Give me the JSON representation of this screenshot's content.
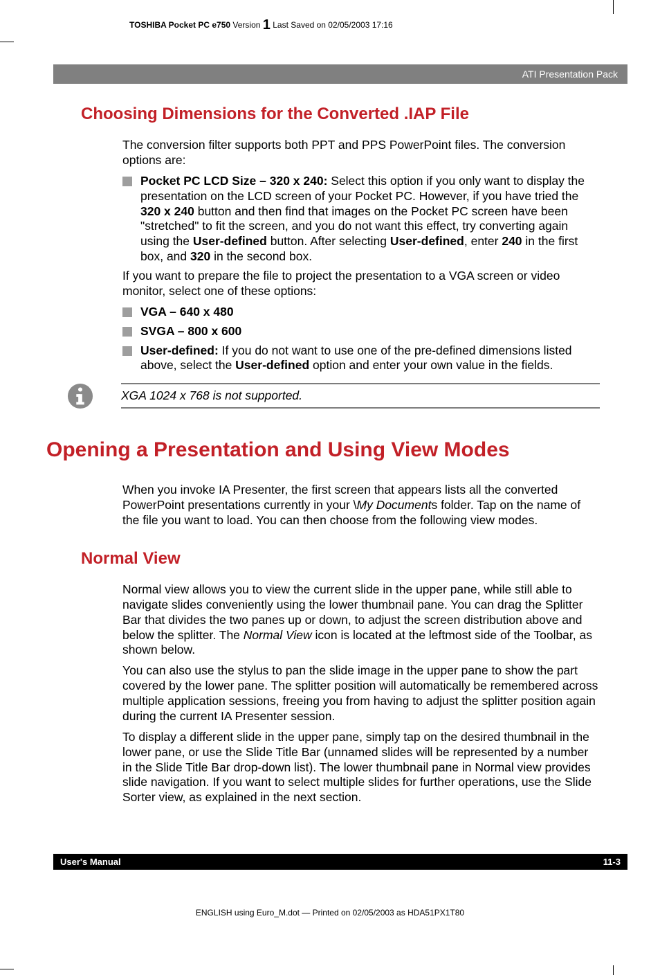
{
  "header": {
    "product": "TOSHIBA Pocket PC e750",
    "version_label": "Version",
    "version_num": "1",
    "save_info": "Last Saved on 02/05/2003 17:16"
  },
  "banner": "ATI Presentation Pack",
  "h2_1": "Choosing Dimensions for the Converted .IAP File",
  "p1": "The conversion filter supports both PPT and PPS PowerPoint files. The conversion options are:",
  "li1_lead": "Pocket PC LCD Size – 320 x 240:",
  "li1_a": " Select this option if you only want to display the presentation on the LCD screen of your Pocket PC. However, if you have tried the ",
  "li1_b": "320 x 240",
  "li1_c": " button and then find that images on the Pocket PC screen have been \"stretched\" to fit the screen, and you do not want this effect, try converting again using the ",
  "li1_d": "User-defined",
  "li1_e": " button. After selecting ",
  "li1_f": "User-defined",
  "li1_g": ", enter ",
  "li1_h": "240",
  "li1_i": " in the first box, and ",
  "li1_j": "320",
  "li1_k": " in the second box.",
  "p2": "If you want to prepare the file to project the presentation to a VGA screen or video monitor, select one of these options:",
  "li2": "VGA – 640 x 480",
  "li3": "SVGA – 800 x 600",
  "li4_lead": "User-defined:",
  "li4_a": " If you do not want to use one of the pre-defined dimensions listed above, select the ",
  "li4_b": "User-defined",
  "li4_c": " option and enter your own value in the fields.",
  "note": "XGA 1024 x 768 is not supported.",
  "h1": "Opening a Presentation and Using View Modes",
  "p3_a": "When you invoke IA Presenter, the first screen that appears lists all the converted PowerPoint presentations currently in your \\",
  "p3_b": "My Document",
  "p3_c": "s folder. Tap on the name of the file you want to load. You can then choose from the following view modes.",
  "h2_2": "Normal View",
  "p4_a": "Normal view allows you to view the current slide in the upper pane, while still able to navigate slides conveniently using the lower thumbnail pane. You can drag the Splitter Bar that divides the two panes up or down, to adjust the screen distribution above and below the splitter. The ",
  "p4_b": "Normal View",
  "p4_c": " icon is located at the leftmost side of the Toolbar, as shown below.",
  "p5": "You can also use the stylus to pan the slide image in the upper pane to show the part covered by the lower pane. The splitter position will automatically be remembered across multiple application sessions, freeing you from having to adjust the splitter position again during the current IA Presenter session.",
  "p6": "To display a different slide in the upper pane, simply tap on the desired thumbnail in the lower pane, or use the Slide Title Bar (unnamed slides will be represented by a number in the Slide Title Bar drop-down list). The lower thumbnail pane in Normal view provides slide navigation. If you want to select multiple slides for further operations, use the Slide Sorter view, as explained in the next section.",
  "footer": {
    "left": "User's Manual",
    "right": "11-3"
  },
  "printline": "ENGLISH using Euro_M.dot — Printed on 02/05/2003 as HDA51PX1T80"
}
